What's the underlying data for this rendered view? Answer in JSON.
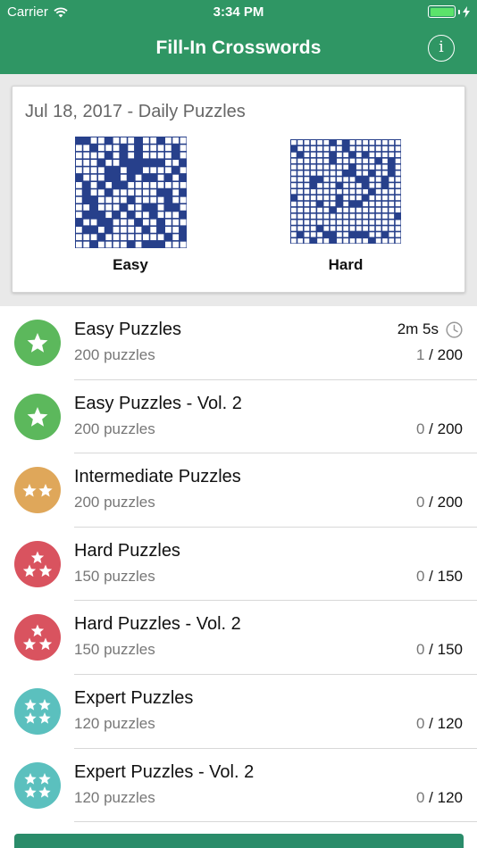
{
  "status_bar": {
    "carrier": "Carrier",
    "time": "3:34 PM"
  },
  "header": {
    "title": "Fill-In Crosswords",
    "info_glyph": "i"
  },
  "daily": {
    "title": "Jul 18, 2017 - Daily Puzzles",
    "puzzles": [
      {
        "label": "Easy",
        "grid_size": 15
      },
      {
        "label": "Hard",
        "grid_size": 17
      }
    ]
  },
  "colors": {
    "header": "#2f9664",
    "grid_blue": "#27408b",
    "easy": "#5cb85c",
    "intermediate": "#dfa75a",
    "hard": "#d9535f",
    "expert": "#5bc0be"
  },
  "collections": [
    {
      "title": "Easy Puzzles",
      "subtitle": "200 puzzles",
      "done": "1",
      "total": " / 200",
      "time": "2m 5s",
      "stars": 1,
      "level": "easy",
      "icon": "star-icon"
    },
    {
      "title": "Easy Puzzles - Vol. 2",
      "subtitle": "200 puzzles",
      "done": "0",
      "total": " / 200",
      "time": "",
      "stars": 1,
      "level": "easy",
      "icon": "star-icon"
    },
    {
      "title": "Intermediate Puzzles",
      "subtitle": "200 puzzles",
      "done": "0",
      "total": " / 200",
      "time": "",
      "stars": 2,
      "level": "intermediate",
      "icon": "two-stars-icon"
    },
    {
      "title": "Hard Puzzles",
      "subtitle": "150 puzzles",
      "done": "0",
      "total": " / 150",
      "time": "",
      "stars": 3,
      "level": "hard",
      "icon": "three-stars-icon"
    },
    {
      "title": "Hard Puzzles - Vol. 2",
      "subtitle": "150 puzzles",
      "done": "0",
      "total": " / 150",
      "time": "",
      "stars": 3,
      "level": "hard",
      "icon": "three-stars-icon"
    },
    {
      "title": "Expert Puzzles",
      "subtitle": "120 puzzles",
      "done": "0",
      "total": " / 120",
      "time": "",
      "stars": 4,
      "level": "expert",
      "icon": "four-stars-icon"
    },
    {
      "title": "Expert Puzzles - Vol. 2",
      "subtitle": "120 puzzles",
      "done": "0",
      "total": " / 120",
      "time": "",
      "stars": 4,
      "level": "expert",
      "icon": "four-stars-icon"
    }
  ]
}
